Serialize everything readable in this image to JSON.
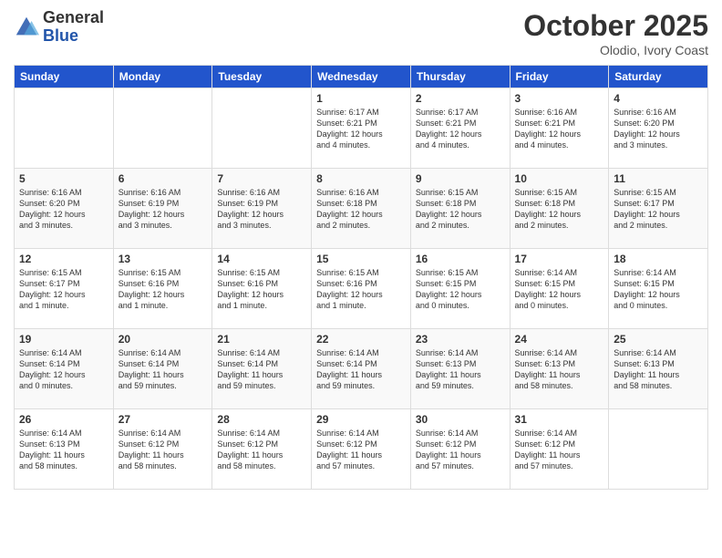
{
  "logo": {
    "general": "General",
    "blue": "Blue"
  },
  "title": "October 2025",
  "subtitle": "Olodio, Ivory Coast",
  "days_of_week": [
    "Sunday",
    "Monday",
    "Tuesday",
    "Wednesday",
    "Thursday",
    "Friday",
    "Saturday"
  ],
  "weeks": [
    [
      {
        "day": "",
        "info": ""
      },
      {
        "day": "",
        "info": ""
      },
      {
        "day": "",
        "info": ""
      },
      {
        "day": "1",
        "info": "Sunrise: 6:17 AM\nSunset: 6:21 PM\nDaylight: 12 hours\nand 4 minutes."
      },
      {
        "day": "2",
        "info": "Sunrise: 6:17 AM\nSunset: 6:21 PM\nDaylight: 12 hours\nand 4 minutes."
      },
      {
        "day": "3",
        "info": "Sunrise: 6:16 AM\nSunset: 6:21 PM\nDaylight: 12 hours\nand 4 minutes."
      },
      {
        "day": "4",
        "info": "Sunrise: 6:16 AM\nSunset: 6:20 PM\nDaylight: 12 hours\nand 3 minutes."
      }
    ],
    [
      {
        "day": "5",
        "info": "Sunrise: 6:16 AM\nSunset: 6:20 PM\nDaylight: 12 hours\nand 3 minutes."
      },
      {
        "day": "6",
        "info": "Sunrise: 6:16 AM\nSunset: 6:19 PM\nDaylight: 12 hours\nand 3 minutes."
      },
      {
        "day": "7",
        "info": "Sunrise: 6:16 AM\nSunset: 6:19 PM\nDaylight: 12 hours\nand 3 minutes."
      },
      {
        "day": "8",
        "info": "Sunrise: 6:16 AM\nSunset: 6:18 PM\nDaylight: 12 hours\nand 2 minutes."
      },
      {
        "day": "9",
        "info": "Sunrise: 6:15 AM\nSunset: 6:18 PM\nDaylight: 12 hours\nand 2 minutes."
      },
      {
        "day": "10",
        "info": "Sunrise: 6:15 AM\nSunset: 6:18 PM\nDaylight: 12 hours\nand 2 minutes."
      },
      {
        "day": "11",
        "info": "Sunrise: 6:15 AM\nSunset: 6:17 PM\nDaylight: 12 hours\nand 2 minutes."
      }
    ],
    [
      {
        "day": "12",
        "info": "Sunrise: 6:15 AM\nSunset: 6:17 PM\nDaylight: 12 hours\nand 1 minute."
      },
      {
        "day": "13",
        "info": "Sunrise: 6:15 AM\nSunset: 6:16 PM\nDaylight: 12 hours\nand 1 minute."
      },
      {
        "day": "14",
        "info": "Sunrise: 6:15 AM\nSunset: 6:16 PM\nDaylight: 12 hours\nand 1 minute."
      },
      {
        "day": "15",
        "info": "Sunrise: 6:15 AM\nSunset: 6:16 PM\nDaylight: 12 hours\nand 1 minute."
      },
      {
        "day": "16",
        "info": "Sunrise: 6:15 AM\nSunset: 6:15 PM\nDaylight: 12 hours\nand 0 minutes."
      },
      {
        "day": "17",
        "info": "Sunrise: 6:14 AM\nSunset: 6:15 PM\nDaylight: 12 hours\nand 0 minutes."
      },
      {
        "day": "18",
        "info": "Sunrise: 6:14 AM\nSunset: 6:15 PM\nDaylight: 12 hours\nand 0 minutes."
      }
    ],
    [
      {
        "day": "19",
        "info": "Sunrise: 6:14 AM\nSunset: 6:14 PM\nDaylight: 12 hours\nand 0 minutes."
      },
      {
        "day": "20",
        "info": "Sunrise: 6:14 AM\nSunset: 6:14 PM\nDaylight: 11 hours\nand 59 minutes."
      },
      {
        "day": "21",
        "info": "Sunrise: 6:14 AM\nSunset: 6:14 PM\nDaylight: 11 hours\nand 59 minutes."
      },
      {
        "day": "22",
        "info": "Sunrise: 6:14 AM\nSunset: 6:14 PM\nDaylight: 11 hours\nand 59 minutes."
      },
      {
        "day": "23",
        "info": "Sunrise: 6:14 AM\nSunset: 6:13 PM\nDaylight: 11 hours\nand 59 minutes."
      },
      {
        "day": "24",
        "info": "Sunrise: 6:14 AM\nSunset: 6:13 PM\nDaylight: 11 hours\nand 58 minutes."
      },
      {
        "day": "25",
        "info": "Sunrise: 6:14 AM\nSunset: 6:13 PM\nDaylight: 11 hours\nand 58 minutes."
      }
    ],
    [
      {
        "day": "26",
        "info": "Sunrise: 6:14 AM\nSunset: 6:13 PM\nDaylight: 11 hours\nand 58 minutes."
      },
      {
        "day": "27",
        "info": "Sunrise: 6:14 AM\nSunset: 6:12 PM\nDaylight: 11 hours\nand 58 minutes."
      },
      {
        "day": "28",
        "info": "Sunrise: 6:14 AM\nSunset: 6:12 PM\nDaylight: 11 hours\nand 58 minutes."
      },
      {
        "day": "29",
        "info": "Sunrise: 6:14 AM\nSunset: 6:12 PM\nDaylight: 11 hours\nand 57 minutes."
      },
      {
        "day": "30",
        "info": "Sunrise: 6:14 AM\nSunset: 6:12 PM\nDaylight: 11 hours\nand 57 minutes."
      },
      {
        "day": "31",
        "info": "Sunrise: 6:14 AM\nSunset: 6:12 PM\nDaylight: 11 hours\nand 57 minutes."
      },
      {
        "day": "",
        "info": ""
      }
    ]
  ]
}
